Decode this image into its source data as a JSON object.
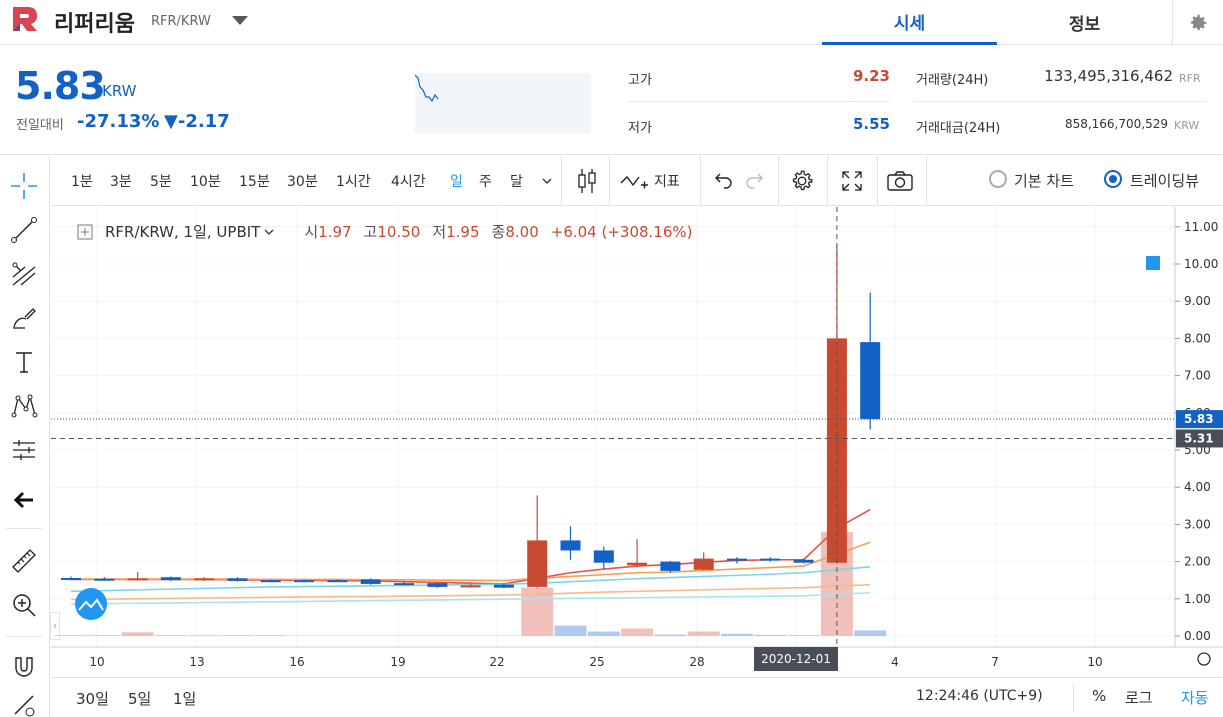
{
  "header": {
    "coin_name": "리퍼리움",
    "coin_pair": "RFR/KRW",
    "tabs": [
      "시세",
      "정보"
    ]
  },
  "summary": {
    "price": "5.83",
    "currency": "KRW",
    "change_label": "전일대비",
    "change_pct": "-27.13%",
    "change_abs": "▼-2.17",
    "high_label": "고가",
    "high_value": "9.23",
    "low_label": "저가",
    "low_value": "5.55",
    "volume_label": "거래량(24H)",
    "volume_value": "133,495,316,462",
    "volume_unit": "RFR",
    "amount_label": "거래대금(24H)",
    "amount_value": "858,166,700,529",
    "amount_unit": "KRW"
  },
  "toolbar": {
    "intervals": [
      "1분",
      "3분",
      "5분",
      "10분",
      "15분",
      "30분",
      "1시간",
      "4시간",
      "일",
      "주",
      "달"
    ],
    "active_interval": "일",
    "indicator_label": "지표",
    "basic_chart_label": "기본 차트",
    "tradingview_label": "트레이딩뷰"
  },
  "legend": {
    "symbol": "RFR/KRW, 1일, UPBIT",
    "open_k": "시",
    "open_v": "1.97",
    "high_k": "고",
    "high_v": "10.50",
    "low_k": "저",
    "low_v": "1.95",
    "close_k": "종",
    "close_v": "8.00",
    "change": "+6.04 (+308.16%)"
  },
  "colors": {
    "up": "#c84a31",
    "down": "#1261c4",
    "accent": "#1261c4"
  },
  "chart_data": {
    "type": "candlestick",
    "x_ticks": [
      "10",
      "13",
      "16",
      "19",
      "22",
      "25",
      "28",
      "2020-12-01",
      "4",
      "7",
      "10"
    ],
    "y_ticks": [
      "11.00",
      "10.00",
      "9.00",
      "8.00",
      "7.00",
      "6.00",
      "5.00",
      "4.00",
      "3.00",
      "2.00",
      "1.00",
      "0.00"
    ],
    "ylim": [
      0,
      11.3
    ],
    "current_price_label": "5.83",
    "crosshair_price_label": "5.31",
    "candles": [
      {
        "i": 0,
        "o": 1.56,
        "h": 1.6,
        "l": 1.5,
        "c": 1.52
      },
      {
        "i": 1,
        "o": 1.54,
        "h": 1.58,
        "l": 1.49,
        "c": 1.52
      },
      {
        "i": 2,
        "o": 1.53,
        "h": 1.72,
        "l": 1.49,
        "c": 1.55
      },
      {
        "i": 3,
        "o": 1.58,
        "h": 1.6,
        "l": 1.48,
        "c": 1.5
      },
      {
        "i": 4,
        "o": 1.52,
        "h": 1.58,
        "l": 1.48,
        "c": 1.55
      },
      {
        "i": 5,
        "o": 1.55,
        "h": 1.58,
        "l": 1.46,
        "c": 1.48
      },
      {
        "i": 6,
        "o": 1.5,
        "h": 1.52,
        "l": 1.46,
        "c": 1.48
      },
      {
        "i": 7,
        "o": 1.5,
        "h": 1.52,
        "l": 1.44,
        "c": 1.48
      },
      {
        "i": 8,
        "o": 1.5,
        "h": 1.52,
        "l": 1.46,
        "c": 1.48
      },
      {
        "i": 9,
        "o": 1.52,
        "h": 1.55,
        "l": 1.38,
        "c": 1.4
      },
      {
        "i": 10,
        "o": 1.42,
        "h": 1.46,
        "l": 1.38,
        "c": 1.4
      },
      {
        "i": 11,
        "o": 1.42,
        "h": 1.45,
        "l": 1.3,
        "c": 1.32
      },
      {
        "i": 12,
        "o": 1.33,
        "h": 1.4,
        "l": 1.3,
        "c": 1.36
      },
      {
        "i": 13,
        "o": 1.38,
        "h": 1.42,
        "l": 1.28,
        "c": 1.3
      },
      {
        "i": 14,
        "o": 1.32,
        "h": 3.78,
        "l": 1.28,
        "c": 2.57
      },
      {
        "i": 15,
        "o": 2.57,
        "h": 2.95,
        "l": 2.05,
        "c": 2.3
      },
      {
        "i": 16,
        "o": 2.3,
        "h": 2.4,
        "l": 1.8,
        "c": 1.97
      },
      {
        "i": 17,
        "o": 1.9,
        "h": 2.6,
        "l": 1.85,
        "c": 1.97
      },
      {
        "i": 18,
        "o": 2.0,
        "h": 2.02,
        "l": 1.7,
        "c": 1.75
      },
      {
        "i": 19,
        "o": 1.78,
        "h": 2.25,
        "l": 1.76,
        "c": 2.08
      },
      {
        "i": 20,
        "o": 2.08,
        "h": 2.12,
        "l": 1.95,
        "c": 2.06
      },
      {
        "i": 21,
        "o": 2.08,
        "h": 2.12,
        "l": 2.0,
        "c": 2.03
      },
      {
        "i": 22,
        "o": 2.05,
        "h": 2.08,
        "l": 1.95,
        "c": 1.97
      },
      {
        "i": 23,
        "o": 1.97,
        "h": 10.5,
        "l": 1.95,
        "c": 8.0
      },
      {
        "i": 24,
        "o": 7.9,
        "h": 9.23,
        "l": 5.55,
        "c": 5.83
      }
    ],
    "volume": [
      0.02,
      0.02,
      0.1,
      0.02,
      0.02,
      0.02,
      0.02,
      0.01,
      0.01,
      0.01,
      0.01,
      0.01,
      0.01,
      0.01,
      1.3,
      0.28,
      0.12,
      0.2,
      0.04,
      0.12,
      0.06,
      0.03,
      0.02,
      2.8,
      0.15
    ],
    "ma_lines": [
      {
        "color": "#e8504a",
        "values": [
          1.52,
          1.52,
          1.52,
          1.52,
          1.52,
          1.51,
          1.5,
          1.5,
          1.49,
          1.48,
          1.46,
          1.44,
          1.42,
          1.4,
          1.55,
          1.7,
          1.8,
          1.88,
          1.92,
          1.98,
          2.03,
          2.05,
          2.05,
          2.9,
          3.4
        ]
      },
      {
        "color": "#f5a050",
        "values": [
          1.53,
          1.53,
          1.53,
          1.53,
          1.53,
          1.53,
          1.52,
          1.52,
          1.52,
          1.51,
          1.51,
          1.5,
          1.5,
          1.49,
          1.55,
          1.6,
          1.65,
          1.7,
          1.72,
          1.76,
          1.8,
          1.84,
          1.88,
          2.2,
          2.52
        ]
      },
      {
        "color": "#7ad6e6",
        "values": [
          1.2,
          1.22,
          1.24,
          1.26,
          1.28,
          1.3,
          1.32,
          1.33,
          1.34,
          1.35,
          1.36,
          1.37,
          1.38,
          1.39,
          1.42,
          1.46,
          1.5,
          1.54,
          1.57,
          1.6,
          1.63,
          1.66,
          1.7,
          1.78,
          1.86
        ]
      },
      {
        "color": "#f7b98a",
        "values": [
          0.98,
          0.99,
          1.0,
          1.01,
          1.02,
          1.03,
          1.04,
          1.05,
          1.06,
          1.06,
          1.07,
          1.08,
          1.09,
          1.1,
          1.12,
          1.15,
          1.18,
          1.2,
          1.22,
          1.24,
          1.26,
          1.28,
          1.3,
          1.34,
          1.38
        ]
      },
      {
        "color": "#a9e3ef",
        "values": [
          0.86,
          0.87,
          0.88,
          0.89,
          0.9,
          0.91,
          0.92,
          0.93,
          0.94,
          0.95,
          0.96,
          0.97,
          0.98,
          0.99,
          1.0,
          1.01,
          1.02,
          1.03,
          1.04,
          1.05,
          1.06,
          1.07,
          1.08,
          1.12,
          1.16
        ]
      }
    ]
  },
  "bottom": {
    "ranges": [
      "30일",
      "5일",
      "1일"
    ],
    "clock": "12:24:46 (UTC+9)",
    "pct_label": "%",
    "log_label": "로그",
    "auto_label": "자동"
  }
}
